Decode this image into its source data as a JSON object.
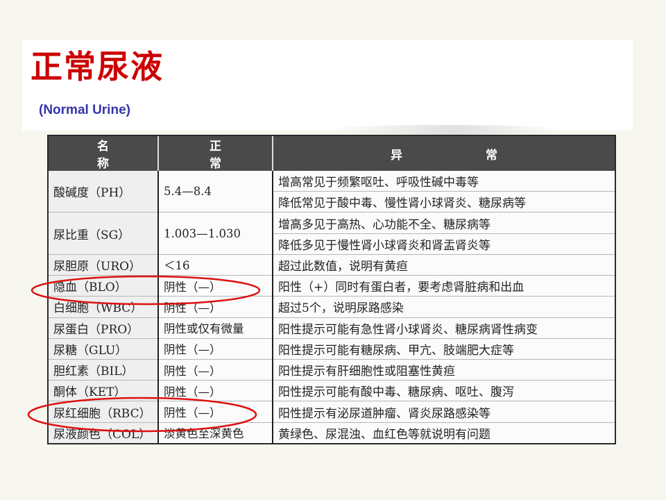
{
  "title": "正常尿液",
  "subtitle": "(Normal Urine)",
  "table": {
    "headers": [
      "名称",
      "正常",
      "异常"
    ],
    "rows": [
      {
        "name": "酸碱度（PH）",
        "normal": "5.4—8.4",
        "abnormal": [
          "增高常见于频繁呕吐、呼吸性碱中毒等",
          "降低常见于酸中毒、慢性肾小球肾炎、糖尿病等"
        ]
      },
      {
        "name": "尿比重（SG）",
        "normal": "1.003—1.030",
        "abnormal": [
          "增高多见于高热、心功能不全、糖尿病等",
          "降低多见于慢性肾小球肾炎和肾盂肾炎等"
        ]
      },
      {
        "name": "尿胆原（URO）",
        "normal": "＜16",
        "abnormal": [
          "超过此数值，说明有黄疸"
        ]
      },
      {
        "name": "隐血（BLO）",
        "normal": "阴性（—）",
        "abnormal": [
          "阳性（+）同时有蛋白者，要考虑肾脏病和出血"
        ]
      },
      {
        "name": "白细胞（WBC）",
        "normal": "阴性（—）",
        "abnormal": [
          "超过5个，说明尿路感染"
        ]
      },
      {
        "name": "尿蛋白（PRO）",
        "normal": "阴性或仅有微量",
        "abnormal": [
          "阳性提示可能有急性肾小球肾炎、糖尿病肾性病变"
        ]
      },
      {
        "name": "尿糖（GLU）",
        "normal": "阴性（—）",
        "abnormal": [
          "阳性提示可能有糖尿病、甲亢、肢端肥大症等"
        ]
      },
      {
        "name": "胆红素（BIL）",
        "normal": "阴性（—）",
        "abnormal": [
          "阳性提示有肝细胞性或阻塞性黄疸"
        ]
      },
      {
        "name": "酮体（KET）",
        "normal": "阴性（—）",
        "abnormal": [
          "阳性提示可能有酸中毒、糖尿病、呕吐、腹泻"
        ]
      },
      {
        "name": "尿红细胞（RBC）",
        "normal": "阴性（—）",
        "abnormal": [
          "阳性提示有泌尿道肿瘤、肾炎尿路感染等"
        ]
      },
      {
        "name": "尿液颜色（COL）",
        "normal": "淡黄色至深黄色",
        "abnormal": [
          "黄绿色、尿混浊、血红色等就说明有问题"
        ]
      }
    ]
  },
  "colors": {
    "title": "#cc0000",
    "subtitle": "#3535a8",
    "header_bg": "#4a4a4a",
    "highlight_oval": "#dd1111"
  }
}
